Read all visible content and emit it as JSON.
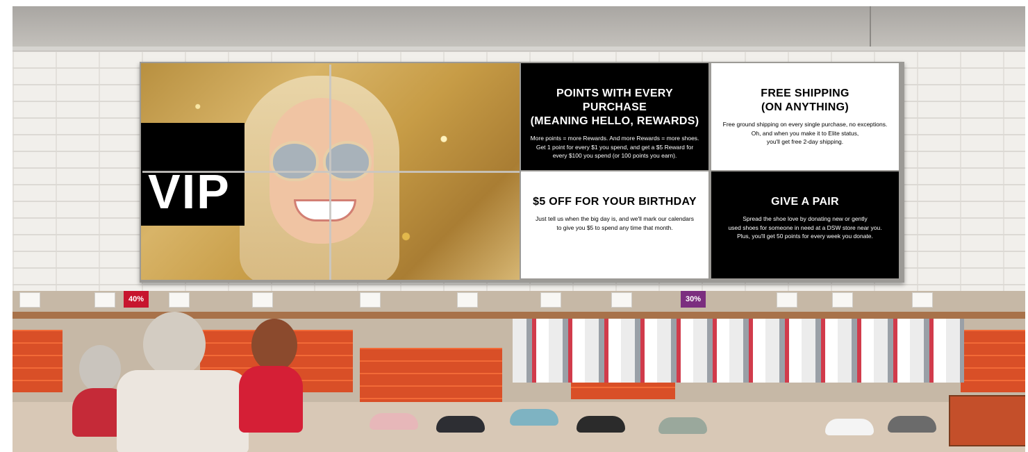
{
  "scene": {
    "vip_label": "VIP",
    "sale_tags": [
      "40%",
      "30%"
    ]
  },
  "panels": [
    {
      "title_line1": "POINTS WITH EVERY PURCHASE",
      "title_line2": "(MEANING HELLO, REWARDS)",
      "body_line1": "More points = more Rewards. And more Rewards = more shoes.",
      "body_line2": "Get 1 point for every $1 you spend, and get a $5 Reward for",
      "body_line3": "every $100 you spend (or 100 points you earn)."
    },
    {
      "title_line1": "FREE SHIPPING",
      "title_line2": "(ON ANYTHING)",
      "body_line1": "Free ground shipping on every single purchase, no exceptions.",
      "body_line2": "Oh, and when you make it to Elite status,",
      "body_line3": "you'll get free 2-day shipping."
    },
    {
      "title_line1": "$5 OFF FOR YOUR BIRTHDAY",
      "title_line2": "",
      "body_line1": "Just tell us when the big day is, and we'll mark our calendars",
      "body_line2": "to give you $5 to spend any time that month.",
      "body_line3": ""
    },
    {
      "title_line1": "GIVE A PAIR",
      "title_line2": "",
      "body_line1": "Spread the shoe love by donating new or gently",
      "body_line2": "used shoes for someone in need at a DSW store near you.",
      "body_line3": "Plus, you'll get 50 points for every week you donate."
    }
  ],
  "colors": {
    "panel_dark": "#000000",
    "panel_light": "#ffffff",
    "sale_red": "#c7152e",
    "sale_purple": "#7b2e7f",
    "shoe_box_orange": "#f26a37"
  }
}
